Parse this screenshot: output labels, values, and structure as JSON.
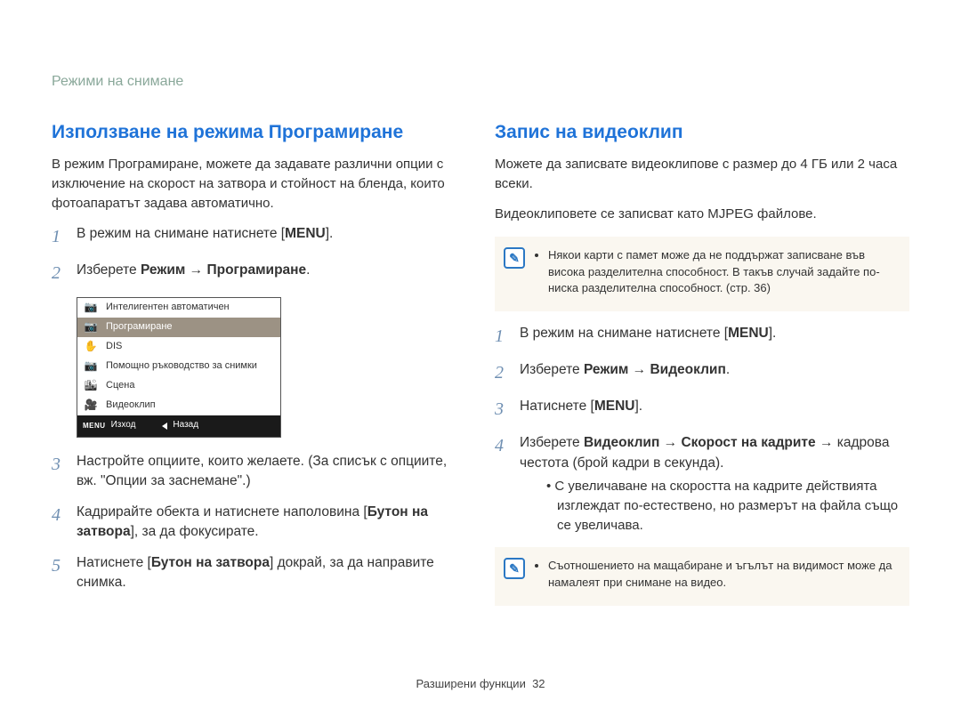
{
  "header": {
    "section_label": "Режими на снимане"
  },
  "left": {
    "title": "Използване на режима Програмиране",
    "intro": "В режим Програмиране, можете да задавате различни опции с изключение на скорост на затвора и стойност на бленда, които фотоапаратът задава автоматично.",
    "step1_a": "В режим на снимане натиснете [",
    "step1_menu": "MENU",
    "step1_b": "].",
    "step2_a": "Изберете ",
    "step2_b": "Режим",
    "step2_c": " → ",
    "step2_d": "Програмиране",
    "step2_e": ".",
    "step3": "Настройте опциите, които желаете. (За списък с опциите, вж. \"Опции за заснемане\".)",
    "step4_a": "Кадрирайте обекта и натиснете наполовина [",
    "step4_b": "Бутон на затвора",
    "step4_c": "], за да фокусирате.",
    "step5_a": "Натиснете [",
    "step5_b": "Бутон на затвора",
    "step5_c": "] докрай, за да направите снимка."
  },
  "camera_modes": {
    "items": [
      {
        "icon": "📷",
        "label": "Интелигентен автоматичен",
        "selected": false
      },
      {
        "icon": "📷",
        "label": "Програмиране",
        "selected": true
      },
      {
        "icon": "✋",
        "label": "DIS",
        "selected": false
      },
      {
        "icon": "📷",
        "label": "Помощно ръководство за снимки",
        "selected": false
      },
      {
        "icon": "🏙",
        "label": "Сцена",
        "selected": false
      },
      {
        "icon": "🎥",
        "label": "Видеоклип",
        "selected": false
      }
    ],
    "footer_menu": "MENU",
    "footer_exit": "Изход",
    "footer_back": "Назад"
  },
  "right": {
    "title": "Запис на видеоклип",
    "intro_a": "Можете да записвате видеоклипове с размер до 4 ГБ или 2 часа всеки.",
    "intro_b": "Видеоклиповете се записват като MJPEG файлове.",
    "note1": "Някои карти с памет може да не поддържат записване във висока разделителна способност. В такъв случай задайте по-ниска разделителна способност. (стр. 36)",
    "step1_a": "В режим на снимане натиснете [",
    "step1_menu": "MENU",
    "step1_b": "].",
    "step2_a": "Изберете ",
    "step2_b": "Режим",
    "step2_c": " → ",
    "step2_d": "Видеоклип",
    "step2_e": ".",
    "step3_a": "Натиснете [",
    "step3_menu": "MENU",
    "step3_b": "].",
    "step4_a": "Изберете ",
    "step4_b": "Видеоклип",
    "step4_c": " → ",
    "step4_d": "Скорост на кадрите",
    "step4_e": " → кадрова честота (брой кадри в секунда).",
    "step4_bullet": "С увеличаване на скоростта на кадрите действията изглеждат по-естествено, но размерът на файла също се увеличава.",
    "note2": "Съотношението на мащабиране и ъгълът на видимост може да намалеят при снимане на видео."
  },
  "footer": {
    "label": "Разширени функции",
    "page": "32"
  }
}
